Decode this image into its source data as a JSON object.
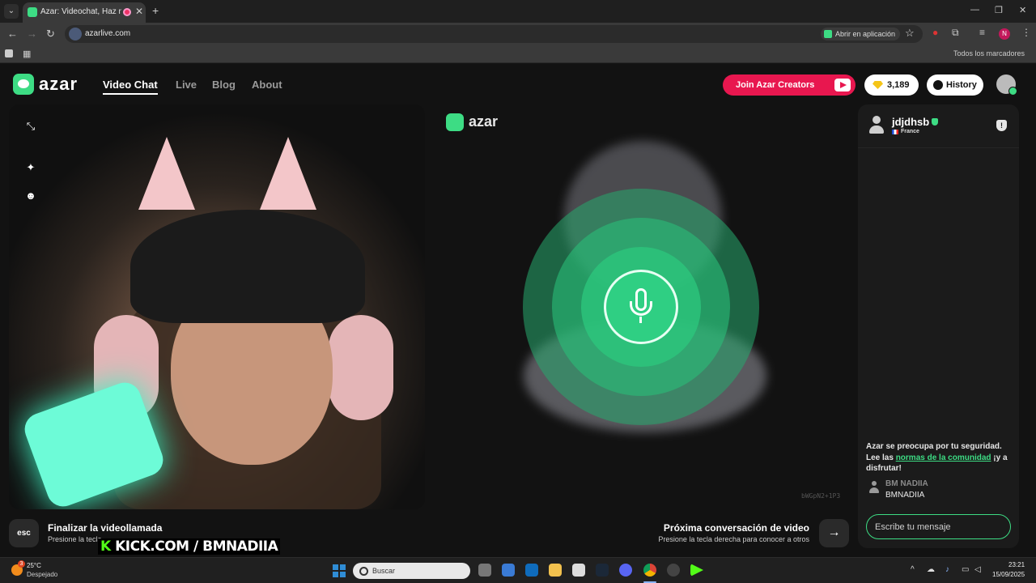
{
  "browser": {
    "tab_title": "Azar: Videochat, Haz nuevo",
    "tab_close": "✕",
    "new_tab": "+",
    "url": "azarlive.com",
    "open_in_app": "Abrir en aplicación",
    "profile_initial": "N",
    "bookmarks_all": "Todos los marcadores",
    "window_controls": [
      "—",
      "❐",
      "✕"
    ]
  },
  "header": {
    "logo": "azar",
    "nav": [
      "Video Chat",
      "Live",
      "Blog",
      "About"
    ],
    "active_nav": "Video Chat",
    "creators_button": "Join Azar Creators",
    "gems": "3,189",
    "history": "History"
  },
  "remote": {
    "logo": "azar",
    "id_code": "bWGpN2+1P3"
  },
  "chat": {
    "username": "jdjdhsb",
    "country": "France",
    "safety_text_1": "Azar se preocupa por tu seguridad. Lee las ",
    "safety_link": "normas de la comunidad",
    "safety_text_2": " ¡y a disfrutar!",
    "message_name": "BM NADIIA",
    "message_text": "BMNADIIA",
    "input_placeholder": "Escribe tu mensaje"
  },
  "controls": {
    "esc_label": "esc",
    "end_title": "Finalizar la videollamada",
    "end_sub": "Presione la tecla",
    "next_title": "Próxima conversación de video",
    "next_sub": "Presione la tecla derecha para conocer a otros",
    "next_arrow": "→"
  },
  "overlay": {
    "k": "K",
    "text": "KICK.COM / BMNADIIA"
  },
  "taskbar": {
    "temperature": "25°C",
    "condition": "Despejado",
    "weather_badge": "3",
    "search": "Buscar",
    "time": "23:21",
    "date": "15/09/2025"
  },
  "colors": {
    "accent_green": "#3ddc84",
    "creators_red": "#e8174f"
  }
}
